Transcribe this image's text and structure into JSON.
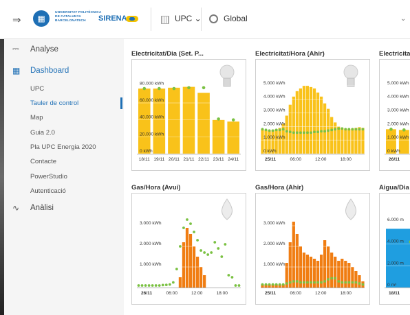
{
  "topbar": {
    "collapse_icon": "collapse-arrow-icon",
    "university": [
      "UNIVERSITAT POLITÈCNICA",
      "DE CATALUNYA",
      "BARCELONATECH"
    ],
    "university_badge": "UPC",
    "brand": "SIRENA",
    "institution": "UPC",
    "scope": "Global"
  },
  "sidebar": {
    "analyse": "Analyse",
    "dashboard": "Dashboard",
    "items": [
      "UPC",
      "Tauler de control",
      "Map",
      "Guia 2.0",
      "Pla UPC Energia 2020",
      "Contacte",
      "PowerStudio",
      "Autenticació"
    ],
    "active_index": 1,
    "analisi": "Anàlisi"
  },
  "colors": {
    "accent": "#1e6fb5",
    "electric": "#f9c21a",
    "gas": "#f07d12",
    "water": "#1f9ee0",
    "line": "#7ac142"
  },
  "charts": [
    {
      "title": "Electricitat/Dia (Set. P...",
      "icon": "lightbulb-icon",
      "chart_data": {
        "type": "bar",
        "unit": "kWh",
        "ylim": [
          0,
          90000
        ],
        "yticks": [
          "0 kWh",
          "20.000 kWh",
          "40.000 kWh",
          "60.000 kWh",
          "80.000 kWh"
        ],
        "categories": [
          "18/11",
          "19/11",
          "20/11",
          "21/11",
          "22/11",
          "23/11",
          "24/11"
        ],
        "values": [
          77000,
          77000,
          78000,
          79000,
          72000,
          40000,
          38000
        ],
        "points": [
          77000,
          77000,
          77000,
          78000,
          78000,
          41000,
          40000
        ]
      }
    },
    {
      "title": "Electricitat/Hora (Ahir)",
      "icon": "lightbulb-icon",
      "chart_data": {
        "type": "bar",
        "unit": "kWh",
        "ylim": [
          0,
          5600
        ],
        "yticks": [
          "0 kWh",
          "1.000 kWh",
          "2.000 kWh",
          "3.000 kWh",
          "4.000 kWh",
          "5.000 kWh"
        ],
        "xticks": [
          "25/11",
          "06:00",
          "12:00",
          "18:00"
        ],
        "values": [
          1800,
          1750,
          1700,
          1750,
          1800,
          1900,
          2200,
          2800,
          3600,
          4200,
          4600,
          4800,
          5000,
          5000,
          4900,
          4800,
          4500,
          4200,
          3700,
          3300,
          2700,
          2300,
          2000,
          1900,
          1850,
          1800,
          1850,
          1900,
          1950,
          1900
        ],
        "points": [
          1800,
          1750,
          1700,
          1700,
          1750,
          1750,
          1800,
          1650,
          1600,
          1550,
          1550,
          1550,
          1550,
          1550,
          1550,
          1600,
          1600,
          1650,
          1650,
          1700,
          1750,
          1800,
          1850,
          1850,
          1800,
          1800,
          1800,
          1800,
          1800,
          1800
        ]
      }
    },
    {
      "title": "Electricitat",
      "icon": "lightbulb-icon",
      "chart_data": {
        "type": "bar",
        "unit": "kWh",
        "ylim": [
          0,
          5600
        ],
        "yticks": [
          "0 kWh",
          "1.000 kWh",
          "2.000 kWh",
          "3.000 kWh",
          "4.000 kWh",
          "5.000 kWh"
        ],
        "xticks": [
          "26/11"
        ],
        "values": [
          1800,
          1750,
          1700,
          1750,
          1800,
          1900,
          2200,
          2800
        ],
        "points": [
          1800,
          1750,
          1700,
          1700,
          1750,
          1750,
          1800,
          1650
        ]
      }
    },
    {
      "title": "Gas/Hora (Avui)",
      "icon": "flame-icon",
      "chart_data": {
        "type": "bar",
        "unit": "kWh",
        "ylim": [
          0,
          3700
        ],
        "yticks": [
          "1.000 kWh",
          "2.000 kWh",
          "3.000 kWh"
        ],
        "xticks": [
          "26/11",
          "06:00",
          "12:00",
          "18:00"
        ],
        "values": [
          0,
          0,
          0,
          0,
          0,
          0,
          0,
          0,
          0,
          0,
          0,
          0,
          500,
          2200,
          2900,
          2600,
          2000,
          1500,
          1000,
          600,
          0,
          0,
          0,
          0,
          0,
          0,
          0,
          0,
          0,
          0
        ],
        "points": [
          100,
          100,
          100,
          100,
          100,
          100,
          100,
          120,
          130,
          150,
          250,
          900,
          2000,
          2900,
          3300,
          3100,
          2700,
          2300,
          1800,
          1700,
          1600,
          1700,
          2200,
          1900,
          1500,
          2100,
          600,
          500,
          100,
          100
        ]
      }
    },
    {
      "title": "Gas/Hora (Ahir)",
      "icon": "flame-icon",
      "chart_data": {
        "type": "bar",
        "unit": "kWh",
        "ylim": [
          0,
          3700
        ],
        "yticks": [
          "1.000 kWh",
          "2.000 kWh",
          "3.000 kWh"
        ],
        "xticks": [
          "25/11",
          "06:00",
          "12:00",
          "18:00"
        ],
        "values": [
          150,
          150,
          150,
          150,
          150,
          150,
          150,
          1200,
          2200,
          3200,
          2600,
          2000,
          1700,
          1600,
          1500,
          1400,
          1300,
          1600,
          2300,
          2000,
          1700,
          1500,
          1300,
          1400,
          1300,
          1200,
          1000,
          800,
          600,
          300
        ],
        "points": [
          150,
          150,
          150,
          150,
          150,
          150,
          150,
          200,
          250,
          300,
          300,
          250,
          250,
          250,
          250,
          250,
          250,
          250,
          300,
          400,
          450,
          450,
          300,
          250,
          250,
          250,
          250,
          250,
          200,
          150
        ]
      }
    },
    {
      "title": "Aigua/Dia",
      "icon": "water-drop-icon",
      "chart_data": {
        "type": "bar",
        "unit": "m³",
        "ylim": [
          0,
          7000
        ],
        "yticks": [
          "0 m³",
          "2.000 m",
          "4.000 m",
          "6.000 m"
        ],
        "xticks": [
          "18/11",
          "19/1"
        ],
        "values": [
          5400,
          5500
        ],
        "points": [
          4200,
          4300
        ]
      }
    }
  ]
}
